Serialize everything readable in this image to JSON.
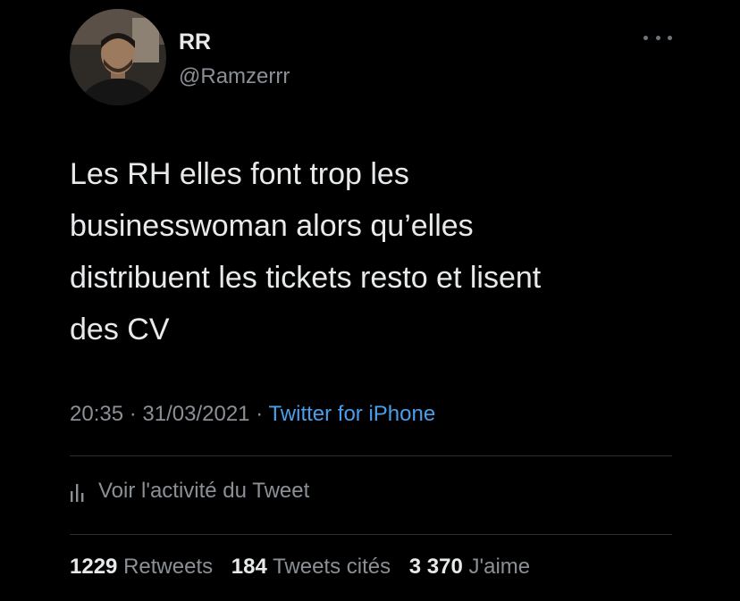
{
  "user": {
    "display_name": "RR",
    "handle": "@Ramzerrr",
    "avatar_icon": "profile-photo"
  },
  "more_icon": "more-horizontal-icon",
  "tweet": {
    "lines": [
      "Les RH elles font trop les",
      "businesswoman alors qu’elles",
      "distribuent les tickets resto et lisent",
      "des CV"
    ]
  },
  "meta": {
    "time": "20:35",
    "separator": "·",
    "date": "31/03/2021",
    "source": "Twitter for iPhone"
  },
  "activity": {
    "icon": "bar-chart-icon",
    "label": "Voir l'activité du Tweet"
  },
  "stats": {
    "retweets_count": "1229",
    "retweets_label": "Retweets",
    "quotes_count": "184",
    "quotes_label": "Tweets cités",
    "likes_count": "3 370",
    "likes_label": "J'aime"
  },
  "colors": {
    "background": "#000000",
    "primary_text": "#e7e9ea",
    "secondary_text": "#8b9096",
    "link": "#4a9eea",
    "divider": "#2a2d31"
  }
}
